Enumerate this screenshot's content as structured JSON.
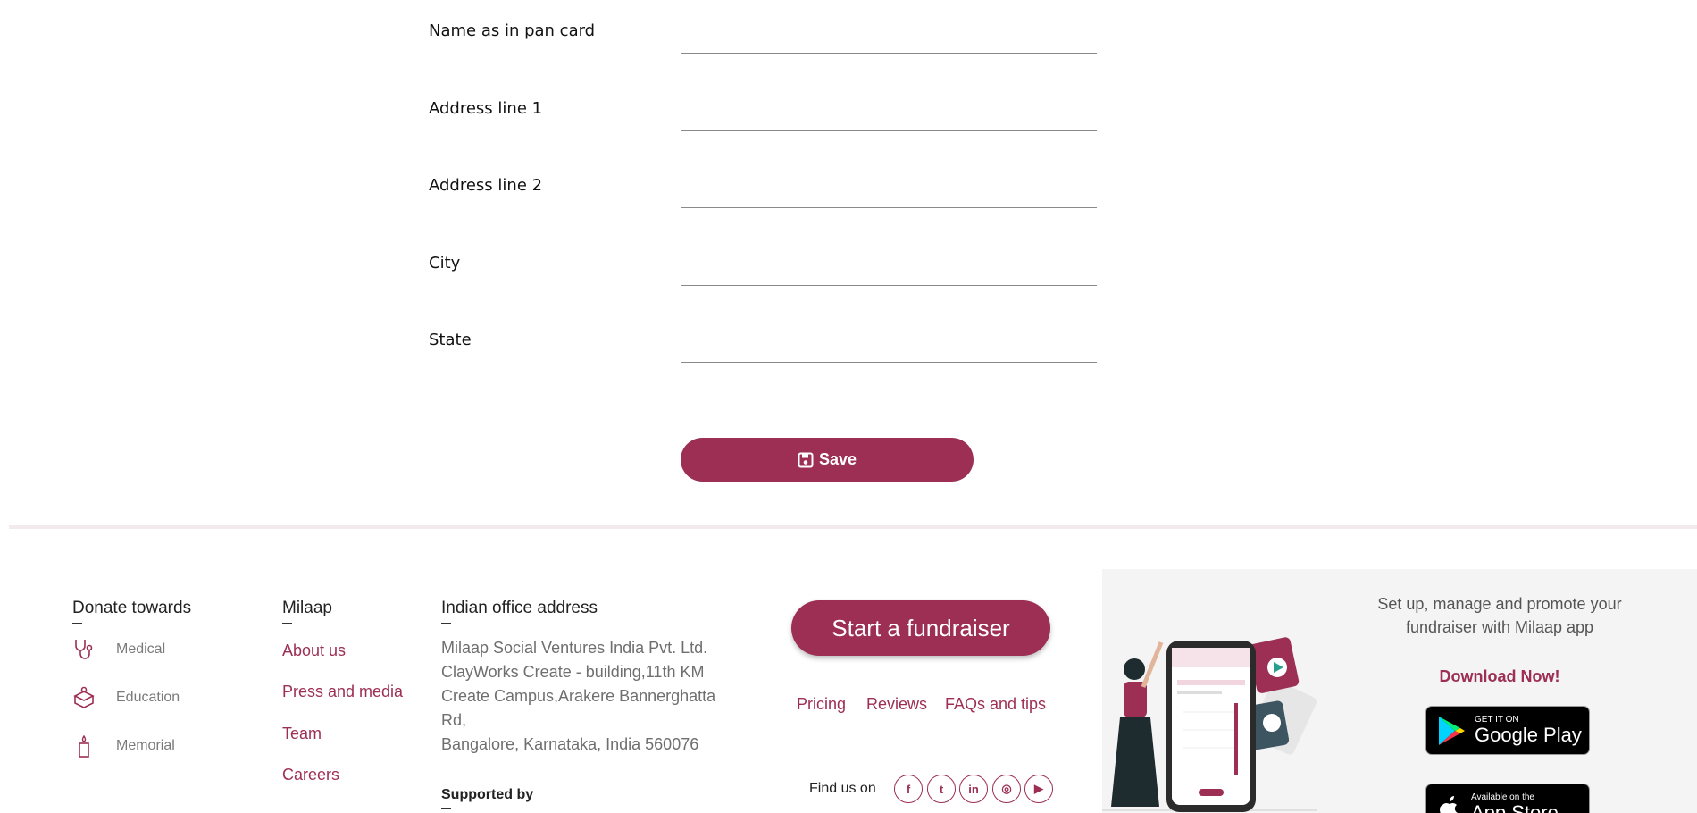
{
  "form": {
    "fields": [
      {
        "label": "Name as in pan card",
        "value": ""
      },
      {
        "label": "Address line 1",
        "value": ""
      },
      {
        "label": "Address line 2",
        "value": ""
      },
      {
        "label": "City",
        "value": ""
      },
      {
        "label": "State",
        "value": ""
      }
    ],
    "save_label": "Save"
  },
  "footer": {
    "donate": {
      "title": "Donate towards",
      "items": [
        {
          "label": "Medical",
          "icon": "stethoscope-icon"
        },
        {
          "label": "Education",
          "icon": "education-icon"
        },
        {
          "label": "Memorial",
          "icon": "candle-icon"
        }
      ]
    },
    "milaap": {
      "title": "Milaap",
      "links": [
        "About us",
        "Press and media",
        "Team",
        "Careers"
      ]
    },
    "office": {
      "title": "Indian office address",
      "lines": [
        "Milaap Social Ventures India Pvt. Ltd.",
        "ClayWorks Create - building,11th KM",
        "Create Campus,Arakere Bannerghatta",
        "Rd,",
        "Bangalore, Karnataka, India 560076"
      ],
      "supported_by": "Supported by"
    },
    "cta": {
      "start_label": "Start a fundraiser",
      "links": [
        "Pricing",
        "Reviews",
        "FAQs and tips"
      ],
      "find_us": "Find us on",
      "social": [
        {
          "name": "facebook-icon",
          "glyph": "f"
        },
        {
          "name": "twitter-icon",
          "glyph": "t"
        },
        {
          "name": "linkedin-icon",
          "glyph": "in"
        },
        {
          "name": "instagram-icon",
          "glyph": "◎"
        },
        {
          "name": "youtube-icon",
          "glyph": "▶"
        }
      ]
    },
    "app": {
      "text": "Set up, manage and promote your fundraiser with Milaap app",
      "download": "Download Now!",
      "google_small": "GET IT ON",
      "google_big": "Google Play",
      "apple_small": "Available on the",
      "apple_big": "App Store"
    }
  },
  "colors": {
    "brand": "#9c2f53",
    "muted_text": "#6f6f6f",
    "panel_bg": "#f4f4f4"
  }
}
